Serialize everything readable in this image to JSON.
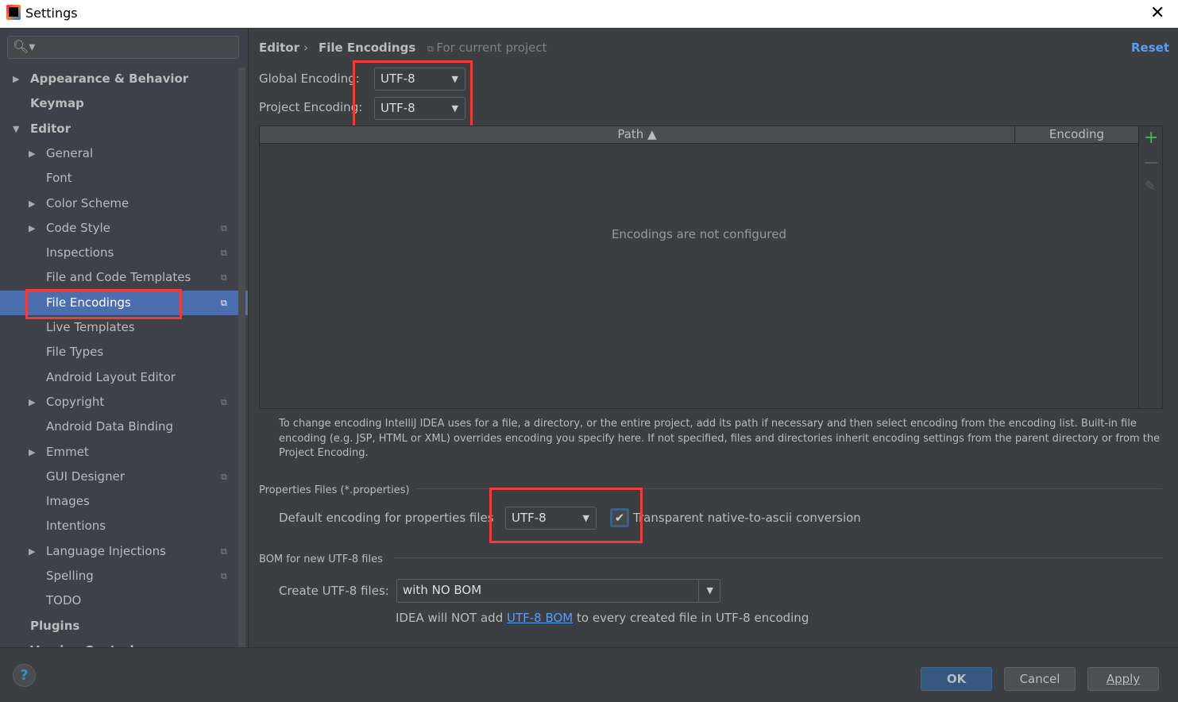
{
  "window": {
    "title": "Settings",
    "close_icon": "close-icon"
  },
  "sidebar": {
    "search_placeholder": "",
    "items": [
      {
        "label": "Appearance & Behavior",
        "level": 0,
        "arrow": "collapsed",
        "bold": true
      },
      {
        "label": "Keymap",
        "level": 0,
        "bold": true
      },
      {
        "label": "Editor",
        "level": 0,
        "arrow": "expanded",
        "bold": true
      },
      {
        "label": "General",
        "level": 1,
        "arrow": "collapsed"
      },
      {
        "label": "Font",
        "level": 1
      },
      {
        "label": "Color Scheme",
        "level": 1,
        "arrow": "collapsed"
      },
      {
        "label": "Code Style",
        "level": 1,
        "arrow": "collapsed",
        "project": true
      },
      {
        "label": "Inspections",
        "level": 1,
        "project": true
      },
      {
        "label": "File and Code Templates",
        "level": 1,
        "project": true
      },
      {
        "label": "File Encodings",
        "level": 1,
        "project": true,
        "selected": true
      },
      {
        "label": "Live Templates",
        "level": 1
      },
      {
        "label": "File Types",
        "level": 1
      },
      {
        "label": "Android Layout Editor",
        "level": 1
      },
      {
        "label": "Copyright",
        "level": 1,
        "arrow": "collapsed",
        "project": true
      },
      {
        "label": "Android Data Binding",
        "level": 1
      },
      {
        "label": "Emmet",
        "level": 1,
        "arrow": "collapsed"
      },
      {
        "label": "GUI Designer",
        "level": 1,
        "project": true
      },
      {
        "label": "Images",
        "level": 1
      },
      {
        "label": "Intentions",
        "level": 1
      },
      {
        "label": "Language Injections",
        "level": 1,
        "arrow": "collapsed",
        "project": true
      },
      {
        "label": "Spelling",
        "level": 1,
        "project": true
      },
      {
        "label": "TODO",
        "level": 1
      },
      {
        "label": "Plugins",
        "level": 0,
        "bold": true
      },
      {
        "label": "Version Control",
        "level": 0,
        "arrow": "collapsed",
        "bold": true,
        "project": true
      }
    ]
  },
  "header": {
    "crumb_parent": "Editor",
    "crumb_sep": "›",
    "crumb_current": "File Encodings",
    "scope": "For current project",
    "reset": "Reset"
  },
  "encodings": {
    "global_label": "Global Encoding:",
    "global_value": "UTF-8",
    "project_label": "Project Encoding:",
    "project_value": "UTF-8"
  },
  "table": {
    "col_path": "Path ▲",
    "col_encoding": "Encoding",
    "empty": "Encodings are not configured",
    "tools": [
      "plus-icon",
      "minus-icon",
      "edit-icon"
    ]
  },
  "note": "To change encoding IntelliJ IDEA uses for a file, a directory, or the entire project, add its path if necessary and then select encoding from the encoding list. Built-in file encoding (e.g. JSP, HTML or XML) overrides encoding you specify here. If not specified, files and directories inherit encoding settings from the parent directory or from the Project Encoding.",
  "properties": {
    "section": "Properties Files (*.properties)",
    "default_label": "Default encoding for properties files",
    "default_value": "UTF-8",
    "native_label": "Transparent native-to-ascii conversion",
    "native_checked": true
  },
  "bom": {
    "section": "BOM for new UTF-8 files",
    "create_label": "Create UTF-8 files:",
    "create_value": "with NO BOM",
    "info_pre": "IDEA will NOT add ",
    "info_link": "UTF-8 BOM",
    "info_post": " to every created file in UTF-8 encoding"
  },
  "footer": {
    "help": "?",
    "ok": "OK",
    "cancel": "Cancel",
    "apply": "Apply"
  },
  "colors": {
    "accent": "#4b6eaf",
    "link": "#589df6",
    "highlight": "#f23a3a",
    "add": "#3fb950"
  }
}
